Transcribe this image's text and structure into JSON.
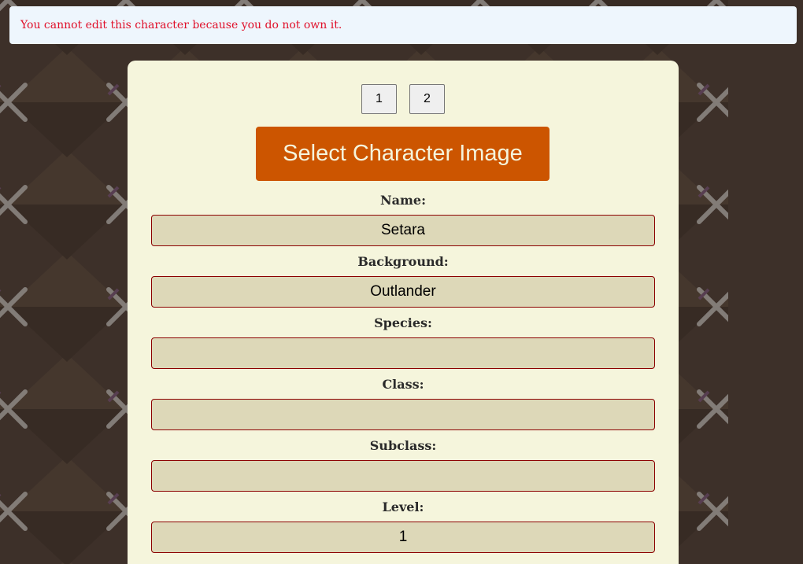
{
  "alert": {
    "message": "You cannot edit this character because you do not own it."
  },
  "pagination": {
    "pages": [
      "1",
      "2"
    ]
  },
  "image_button": {
    "label": "Select Character Image"
  },
  "fields": {
    "name": {
      "label": "Name:",
      "value": "Setara"
    },
    "background": {
      "label": "Background:",
      "value": "Outlander"
    },
    "species": {
      "label": "Species:",
      "value": ""
    },
    "class": {
      "label": "Class:",
      "value": ""
    },
    "subclass": {
      "label": "Subclass:",
      "value": ""
    },
    "level": {
      "label": "Level:",
      "value": "1"
    }
  },
  "colors": {
    "page_background": "#3d3029",
    "alert_background": "#eef6fd",
    "alert_text": "#e0102a",
    "card_background": "#f5f5dc",
    "accent_button": "#cc5500",
    "input_background": "#ddd8b8",
    "input_border": "#8b0000"
  },
  "icons": {
    "background_pattern": "crossed-swords-icon"
  }
}
